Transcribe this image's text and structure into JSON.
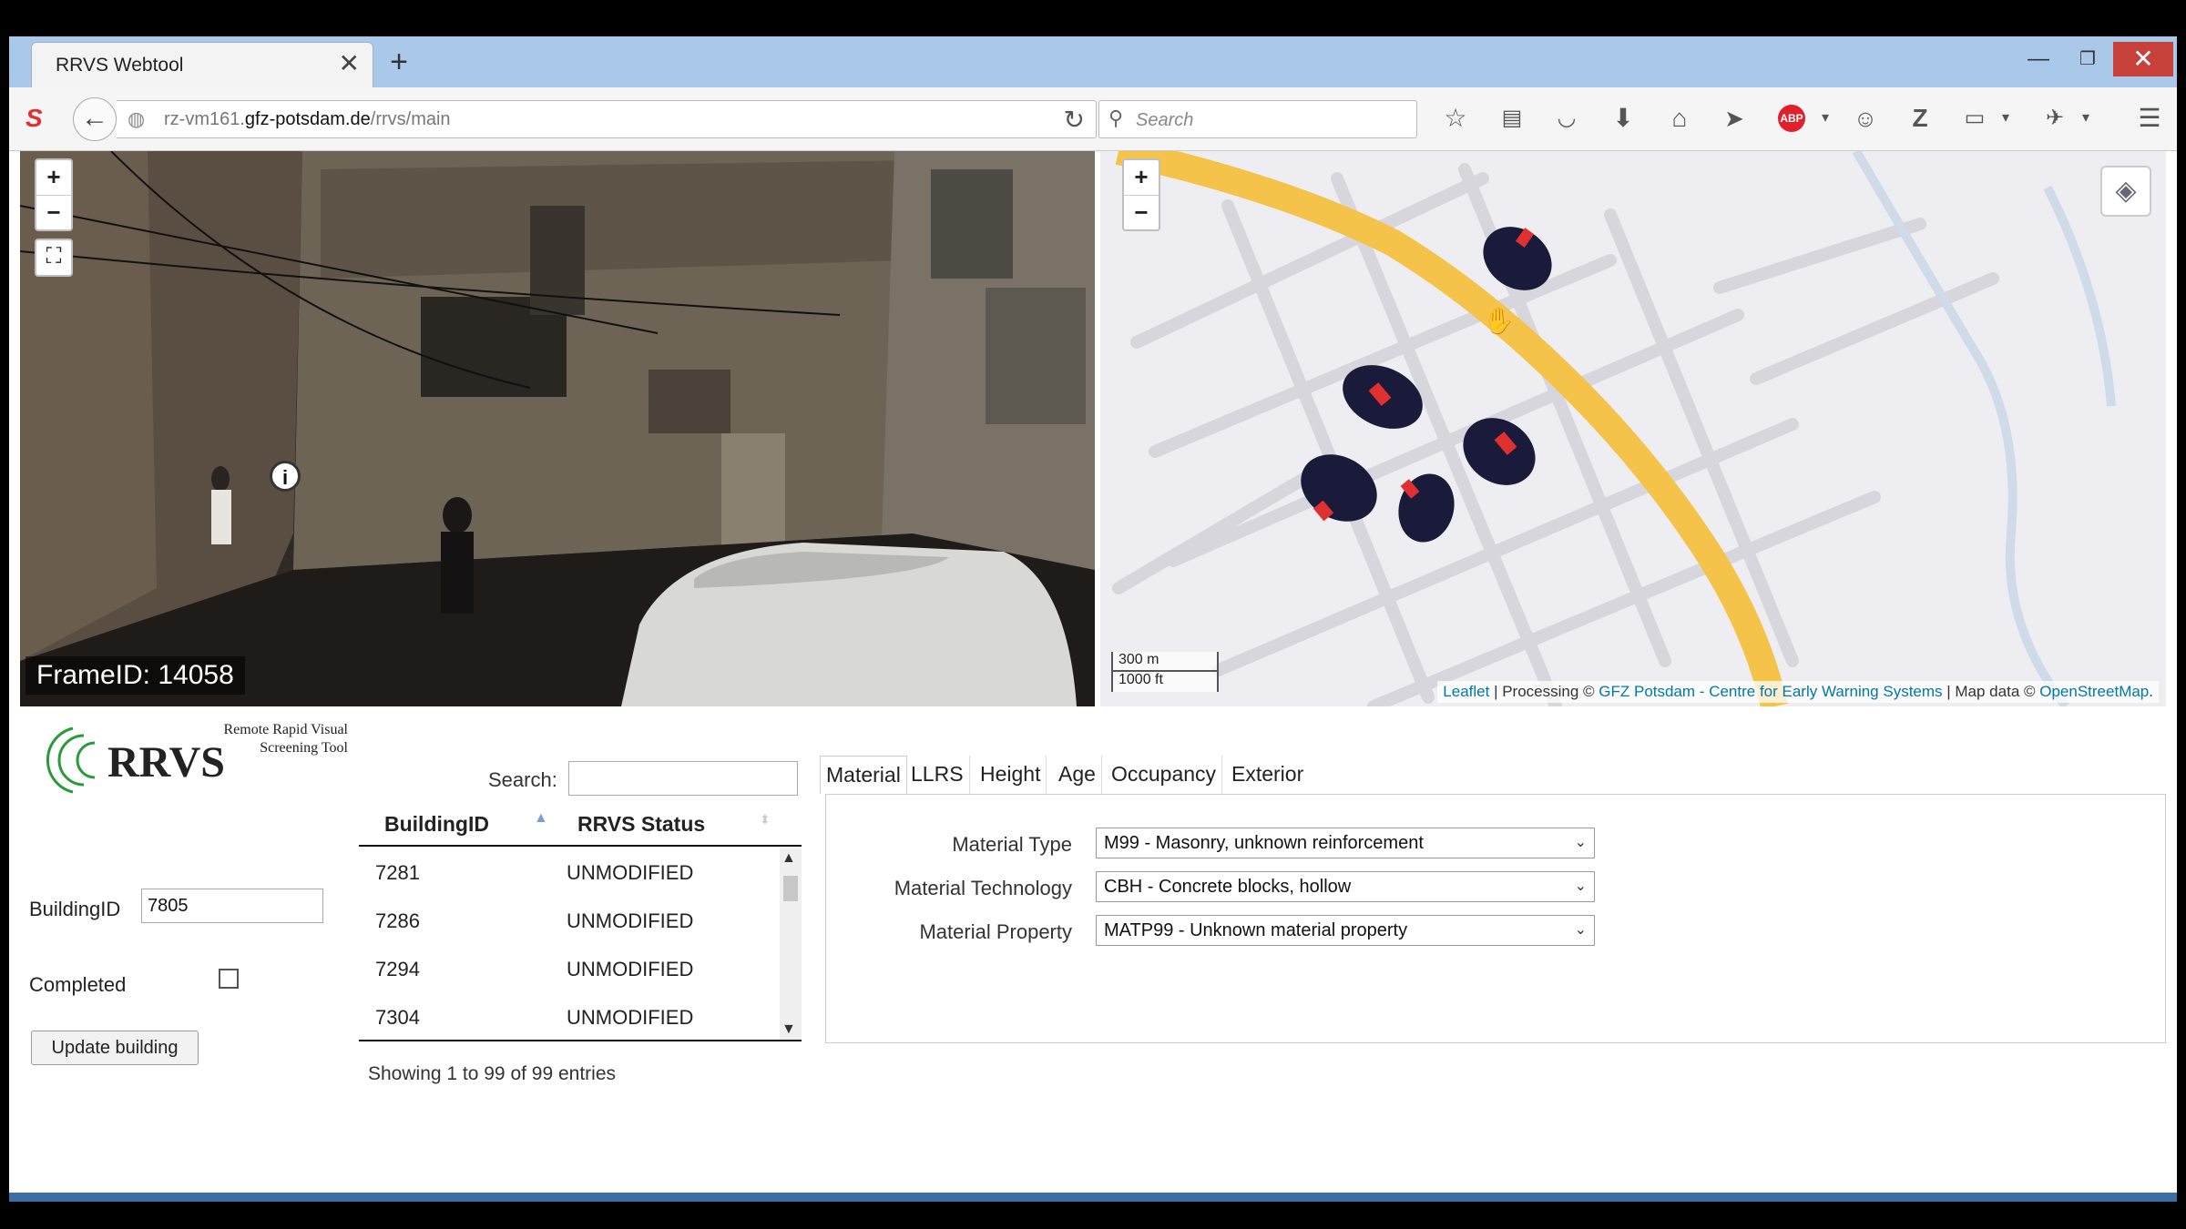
{
  "browser": {
    "tab_title": "RRVS Webtool",
    "tab_close": "✕",
    "new_tab": "+",
    "window_controls": {
      "minimize": "—",
      "maximize": "❐",
      "close": "✕"
    },
    "url_prefix": "rz-vm161.",
    "url_domain": "gfz-potsdam.de",
    "url_path": "/rrvs/main",
    "search_placeholder": "Search",
    "toolbar_icons": [
      "star-icon",
      "reading-list-icon",
      "pocket-icon",
      "download-icon",
      "home-icon",
      "send-icon",
      "adblock-icon",
      "chat-icon",
      "zotero-icon",
      "page-icon",
      "extension-icon",
      "menu-icon"
    ],
    "adblock_label": "ABP"
  },
  "image_panel": {
    "zoom_in": "+",
    "zoom_out": "−",
    "fullscreen": "⛶",
    "info": "i",
    "frame_label": "FrameID: 14058"
  },
  "map_panel": {
    "zoom_in": "+",
    "zoom_out": "−",
    "layers_icon": "layers-icon",
    "scale_m": "300 m",
    "scale_ft": "1000 ft",
    "attribution": {
      "leaflet": "Leaflet",
      "processing": " | Processing © ",
      "gfz": "GFZ Potsdam - Centre for Early Warning Systems",
      "mapdata": " | Map data © ",
      "osm": "OpenStreetMap",
      "end": "."
    }
  },
  "logo": {
    "text": "RRVS",
    "subtitle_line1": "Remote Rapid Visual",
    "subtitle_line2": "Screening Tool"
  },
  "form": {
    "building_id_label": "BuildingID",
    "building_id_value": "7805",
    "completed_label": "Completed",
    "completed_checked": false,
    "update_button": "Update building"
  },
  "table": {
    "search_label": "Search:",
    "search_value": "",
    "columns": [
      "BuildingID",
      "RRVS Status"
    ],
    "rows": [
      {
        "id": "7281",
        "status": "UNMODIFIED"
      },
      {
        "id": "7286",
        "status": "UNMODIFIED"
      },
      {
        "id": "7294",
        "status": "UNMODIFIED"
      },
      {
        "id": "7304",
        "status": "UNMODIFIED"
      }
    ],
    "info": "Showing 1 to 99 of 99 entries"
  },
  "attributes": {
    "tabs": [
      "Material",
      "LLRS",
      "Height",
      "Age",
      "Occupancy",
      "Exterior Walls"
    ],
    "active_tab": "Material",
    "fields": [
      {
        "label": "Material Type",
        "value": "M99 - Masonry, unknown reinforcement"
      },
      {
        "label": "Material Technology",
        "value": "CBH - Concrete blocks, hollow"
      },
      {
        "label": "Material Property",
        "value": "MATP99 - Unknown material property"
      }
    ]
  },
  "colors": {
    "accent_link": "#0078a8",
    "road": "#f5c24a",
    "marker": "#1a1a3a",
    "marker_flag": "#e03030",
    "tabbar": "#a9c8ea"
  }
}
